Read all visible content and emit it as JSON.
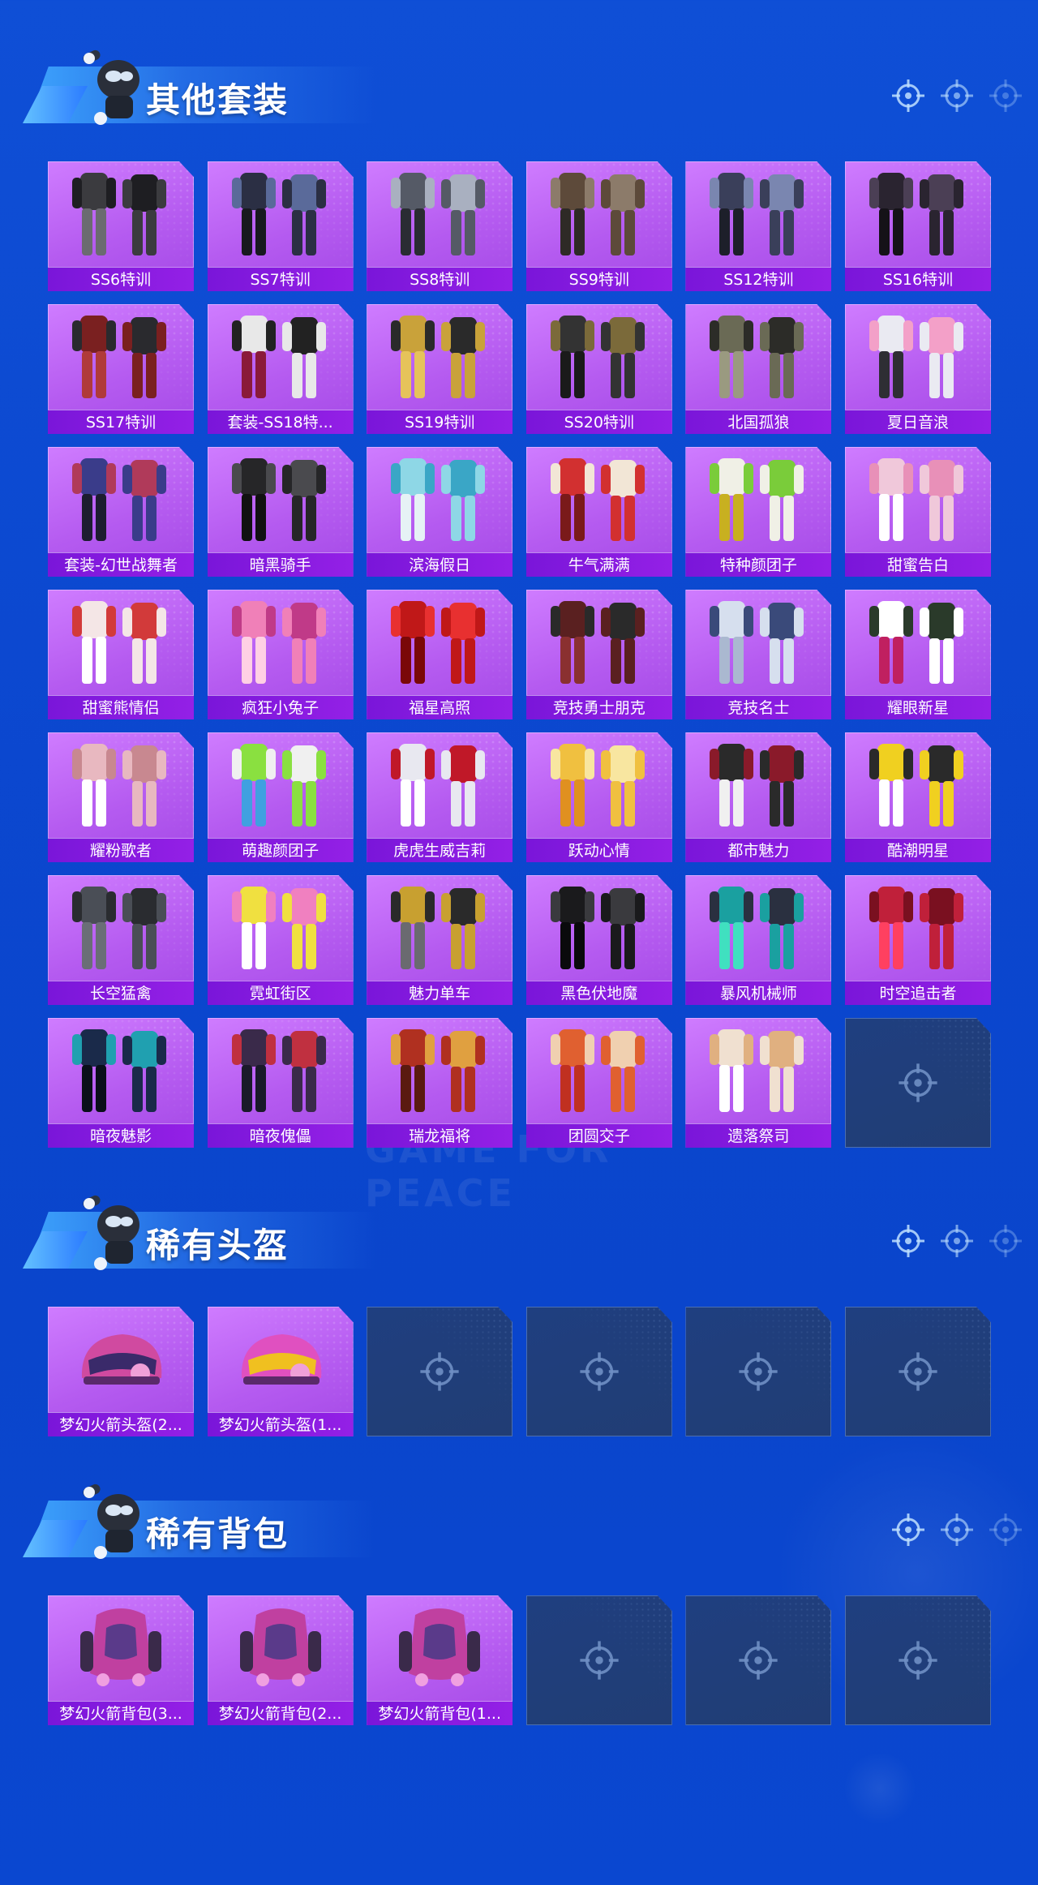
{
  "sections": [
    {
      "title": "其他套装",
      "items": [
        {
          "label": "SS6特训",
          "kind": "suit"
        },
        {
          "label": "SS7特训",
          "kind": "suit"
        },
        {
          "label": "SS8特训",
          "kind": "suit"
        },
        {
          "label": "SS9特训",
          "kind": "suit"
        },
        {
          "label": "SS12特训",
          "kind": "suit"
        },
        {
          "label": "SS16特训",
          "kind": "suit"
        },
        {
          "label": "SS17特训",
          "kind": "suit"
        },
        {
          "label": "套装-SS18特...",
          "kind": "suit"
        },
        {
          "label": "SS19特训",
          "kind": "suit"
        },
        {
          "label": "SS20特训",
          "kind": "suit"
        },
        {
          "label": "北国孤狼",
          "kind": "suit"
        },
        {
          "label": "夏日音浪",
          "kind": "suit"
        },
        {
          "label": "套装-幻世战舞者",
          "kind": "suit"
        },
        {
          "label": "暗黑骑手",
          "kind": "suit"
        },
        {
          "label": "滨海假日",
          "kind": "suit"
        },
        {
          "label": "牛气满满",
          "kind": "suit"
        },
        {
          "label": "特种颜团子",
          "kind": "suit"
        },
        {
          "label": "甜蜜告白",
          "kind": "suit"
        },
        {
          "label": "甜蜜熊情侣",
          "kind": "suit"
        },
        {
          "label": "疯狂小兔子",
          "kind": "suit"
        },
        {
          "label": "福星高照",
          "kind": "suit"
        },
        {
          "label": "竞技勇士朋克",
          "kind": "suit"
        },
        {
          "label": "竞技名士",
          "kind": "suit"
        },
        {
          "label": "耀眼新星",
          "kind": "suit"
        },
        {
          "label": "耀粉歌者",
          "kind": "suit"
        },
        {
          "label": "萌趣颜团子",
          "kind": "suit"
        },
        {
          "label": "虎虎生威吉莉",
          "kind": "suit"
        },
        {
          "label": "跃动心情",
          "kind": "suit"
        },
        {
          "label": "都市魅力",
          "kind": "suit"
        },
        {
          "label": "酷潮明星",
          "kind": "suit"
        },
        {
          "label": "长空猛禽",
          "kind": "suit"
        },
        {
          "label": "霓虹街区",
          "kind": "suit"
        },
        {
          "label": "魅力单车",
          "kind": "suit"
        },
        {
          "label": "黑色伏地魔",
          "kind": "suit"
        },
        {
          "label": "暴风机械师",
          "kind": "suit"
        },
        {
          "label": "时空追击者",
          "kind": "suit"
        },
        {
          "label": "暗夜魅影",
          "kind": "suit"
        },
        {
          "label": "暗夜傀儡",
          "kind": "suit"
        },
        {
          "label": "瑞龙福将",
          "kind": "suit"
        },
        {
          "label": "团圆交子",
          "kind": "suit"
        },
        {
          "label": "遗落祭司",
          "kind": "suit"
        },
        {
          "label": "",
          "kind": "empty"
        }
      ]
    },
    {
      "title": "稀有头盔",
      "items": [
        {
          "label": "梦幻火箭头盔(2...",
          "kind": "helmet"
        },
        {
          "label": "梦幻火箭头盔(1...",
          "kind": "helmet"
        },
        {
          "label": "",
          "kind": "empty"
        },
        {
          "label": "",
          "kind": "empty"
        },
        {
          "label": "",
          "kind": "empty"
        },
        {
          "label": "",
          "kind": "empty"
        }
      ]
    },
    {
      "title": "稀有背包",
      "items": [
        {
          "label": "梦幻火箭背包(3...",
          "kind": "backpack"
        },
        {
          "label": "梦幻火箭背包(2...",
          "kind": "backpack"
        },
        {
          "label": "梦幻火箭背包(1...",
          "kind": "backpack"
        },
        {
          "label": "",
          "kind": "empty"
        },
        {
          "label": "",
          "kind": "empty"
        },
        {
          "label": "",
          "kind": "empty"
        }
      ]
    }
  ],
  "icons": {
    "header_targets": [
      "crosshair-icon",
      "crosshair-icon",
      "crosshair-icon"
    ],
    "empty_slot": "crosshair-icon"
  },
  "watermark": "GAME FOR PEACE",
  "colors": {
    "background": "#0b47cf",
    "card_purple": "#b55bf0",
    "card_label": "#8a1de0",
    "empty_slot": "#213d74"
  }
}
